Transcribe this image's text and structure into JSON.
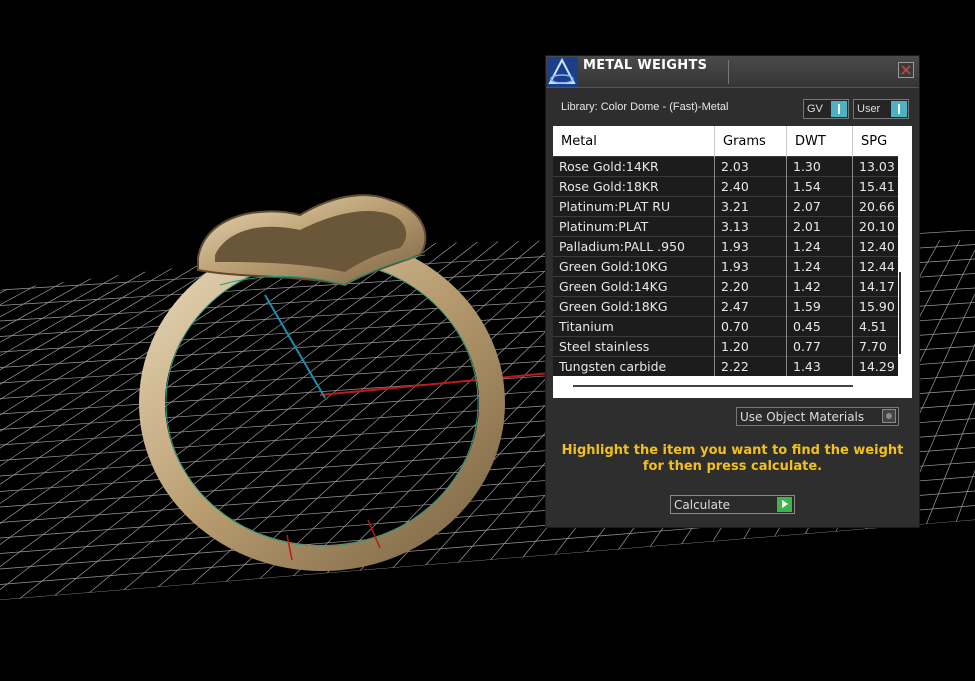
{
  "panel": {
    "title": "METAL WEIGHTS",
    "library_label": "Library: Color Dome - (Fast)-Metal",
    "gv_toggle_label": "GV",
    "user_toggle_label": "User",
    "use_object_materials_label": "Use Object Materials",
    "hint_text": "Highlight the item you want to find the weight for then press calculate.",
    "calculate_label": "Calculate"
  },
  "table": {
    "columns": [
      "Metal",
      "Grams",
      "DWT",
      "SPG"
    ],
    "rows": [
      {
        "metal": "Rose Gold:14KR",
        "grams": "2.03",
        "dwt": "1.30",
        "spg": "13.03"
      },
      {
        "metal": "Rose Gold:18KR",
        "grams": "2.40",
        "dwt": "1.54",
        "spg": "15.41"
      },
      {
        "metal": "Platinum:PLAT RU",
        "grams": "3.21",
        "dwt": "2.07",
        "spg": "20.66"
      },
      {
        "metal": "Platinum:PLAT",
        "grams": "3.13",
        "dwt": "2.01",
        "spg": "20.10"
      },
      {
        "metal": "Palladium:PALL .950",
        "grams": "1.93",
        "dwt": "1.24",
        "spg": "12.40"
      },
      {
        "metal": "Green Gold:10KG",
        "grams": "1.93",
        "dwt": "1.24",
        "spg": "12.44"
      },
      {
        "metal": "Green Gold:14KG",
        "grams": "2.20",
        "dwt": "1.42",
        "spg": "14.17"
      },
      {
        "metal": "Green Gold:18KG",
        "grams": "2.47",
        "dwt": "1.59",
        "spg": "15.90"
      },
      {
        "metal": "Titanium",
        "grams": "0.70",
        "dwt": "0.45",
        "spg": "4.51"
      },
      {
        "metal": "Steel stainless",
        "grams": "1.20",
        "dwt": "0.77",
        "spg": "7.70"
      },
      {
        "metal": "Tungsten carbide",
        "grams": "2.22",
        "dwt": "1.43",
        "spg": "14.29"
      }
    ]
  },
  "colors": {
    "hint": "#f2c01c",
    "toggle_knob": "#4bb3c3",
    "calculate_arrow": "#3db54a",
    "ring_metal": "#cbb48c"
  },
  "icons": [
    "app-logo-icon",
    "close-icon",
    "toggle-knob-icon",
    "radio-icon",
    "play-arrow-icon"
  ]
}
